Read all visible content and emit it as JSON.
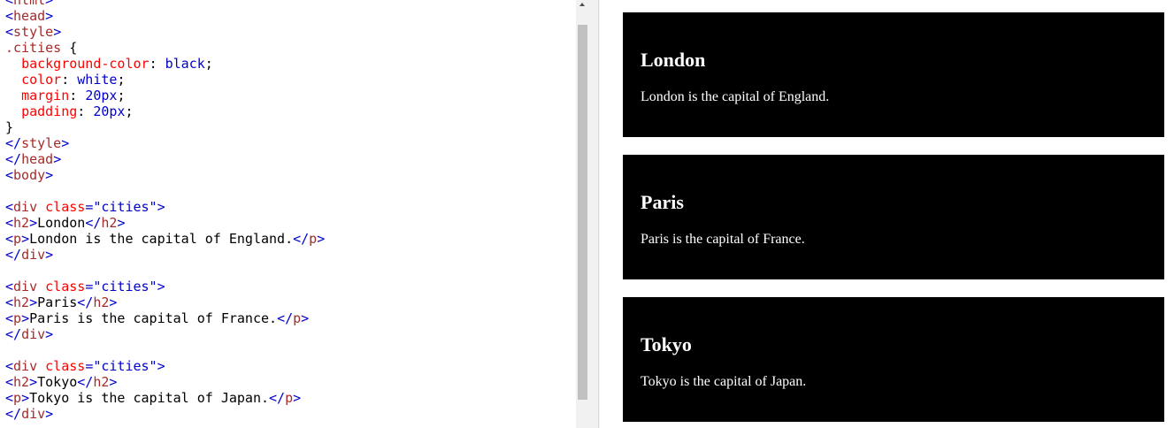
{
  "editor": {
    "lines": [
      [
        [
          "tok-bracket",
          "<"
        ],
        [
          "tok-tag",
          "html"
        ],
        [
          "tok-bracket",
          ">"
        ]
      ],
      [
        [
          "tok-bracket",
          "<"
        ],
        [
          "tok-tag",
          "head"
        ],
        [
          "tok-bracket",
          ">"
        ]
      ],
      [
        [
          "tok-bracket",
          "<"
        ],
        [
          "tok-tag",
          "style"
        ],
        [
          "tok-bracket",
          ">"
        ]
      ],
      [
        [
          "tok-selector",
          ".cities"
        ],
        [
          "tok-punct",
          " {"
        ]
      ],
      [
        [
          "tok-punct",
          "  "
        ],
        [
          "tok-prop",
          "background-color"
        ],
        [
          "tok-punct",
          ": "
        ],
        [
          "tok-value",
          "black"
        ],
        [
          "tok-punct",
          ";"
        ]
      ],
      [
        [
          "tok-punct",
          "  "
        ],
        [
          "tok-prop",
          "color"
        ],
        [
          "tok-punct",
          ": "
        ],
        [
          "tok-value",
          "white"
        ],
        [
          "tok-punct",
          ";"
        ]
      ],
      [
        [
          "tok-punct",
          "  "
        ],
        [
          "tok-prop",
          "margin"
        ],
        [
          "tok-punct",
          ": "
        ],
        [
          "tok-value",
          "20px"
        ],
        [
          "tok-punct",
          ";"
        ]
      ],
      [
        [
          "tok-punct",
          "  "
        ],
        [
          "tok-prop",
          "padding"
        ],
        [
          "tok-punct",
          ": "
        ],
        [
          "tok-value",
          "20px"
        ],
        [
          "tok-punct",
          ";"
        ]
      ],
      [
        [
          "tok-punct",
          "}"
        ]
      ],
      [
        [
          "tok-bracket",
          "</"
        ],
        [
          "tok-tag",
          "style"
        ],
        [
          "tok-bracket",
          ">"
        ]
      ],
      [
        [
          "tok-bracket",
          "</"
        ],
        [
          "tok-tag",
          "head"
        ],
        [
          "tok-bracket",
          ">"
        ]
      ],
      [
        [
          "tok-bracket",
          "<"
        ],
        [
          "tok-tag",
          "body"
        ],
        [
          "tok-bracket",
          ">"
        ]
      ],
      [],
      [
        [
          "tok-bracket",
          "<"
        ],
        [
          "tok-tag",
          "div"
        ],
        [
          "tok-text",
          " "
        ],
        [
          "tok-attr",
          "class"
        ],
        [
          "tok-bracket",
          "="
        ],
        [
          "tok-value",
          "\"cities\""
        ],
        [
          "tok-bracket",
          ">"
        ]
      ],
      [
        [
          "tok-bracket",
          "<"
        ],
        [
          "tok-tag",
          "h2"
        ],
        [
          "tok-bracket",
          ">"
        ],
        [
          "tok-text",
          "London"
        ],
        [
          "tok-bracket",
          "</"
        ],
        [
          "tok-tag",
          "h2"
        ],
        [
          "tok-bracket",
          ">"
        ]
      ],
      [
        [
          "tok-bracket",
          "<"
        ],
        [
          "tok-tag",
          "p"
        ],
        [
          "tok-bracket",
          ">"
        ],
        [
          "tok-text",
          "London is the capital of England."
        ],
        [
          "tok-bracket",
          "</"
        ],
        [
          "tok-tag",
          "p"
        ],
        [
          "tok-bracket",
          ">"
        ]
      ],
      [
        [
          "tok-bracket",
          "</"
        ],
        [
          "tok-tag",
          "div"
        ],
        [
          "tok-bracket",
          ">"
        ]
      ],
      [],
      [
        [
          "tok-bracket",
          "<"
        ],
        [
          "tok-tag",
          "div"
        ],
        [
          "tok-text",
          " "
        ],
        [
          "tok-attr",
          "class"
        ],
        [
          "tok-bracket",
          "="
        ],
        [
          "tok-value",
          "\"cities\""
        ],
        [
          "tok-bracket",
          ">"
        ]
      ],
      [
        [
          "tok-bracket",
          "<"
        ],
        [
          "tok-tag",
          "h2"
        ],
        [
          "tok-bracket",
          ">"
        ],
        [
          "tok-text",
          "Paris"
        ],
        [
          "tok-bracket",
          "</"
        ],
        [
          "tok-tag",
          "h2"
        ],
        [
          "tok-bracket",
          ">"
        ]
      ],
      [
        [
          "tok-bracket",
          "<"
        ],
        [
          "tok-tag",
          "p"
        ],
        [
          "tok-bracket",
          ">"
        ],
        [
          "tok-text",
          "Paris is the capital of France."
        ],
        [
          "tok-bracket",
          "</"
        ],
        [
          "tok-tag",
          "p"
        ],
        [
          "tok-bracket",
          ">"
        ]
      ],
      [
        [
          "tok-bracket",
          "</"
        ],
        [
          "tok-tag",
          "div"
        ],
        [
          "tok-bracket",
          ">"
        ]
      ],
      [],
      [
        [
          "tok-bracket",
          "<"
        ],
        [
          "tok-tag",
          "div"
        ],
        [
          "tok-text",
          " "
        ],
        [
          "tok-attr",
          "class"
        ],
        [
          "tok-bracket",
          "="
        ],
        [
          "tok-value",
          "\"cities\""
        ],
        [
          "tok-bracket",
          ">"
        ]
      ],
      [
        [
          "tok-bracket",
          "<"
        ],
        [
          "tok-tag",
          "h2"
        ],
        [
          "tok-bracket",
          ">"
        ],
        [
          "tok-text",
          "Tokyo"
        ],
        [
          "tok-bracket",
          "</"
        ],
        [
          "tok-tag",
          "h2"
        ],
        [
          "tok-bracket",
          ">"
        ]
      ],
      [
        [
          "tok-bracket",
          "<"
        ],
        [
          "tok-tag",
          "p"
        ],
        [
          "tok-bracket",
          ">"
        ],
        [
          "tok-text",
          "Tokyo is the capital of Japan."
        ],
        [
          "tok-bracket",
          "</"
        ],
        [
          "tok-tag",
          "p"
        ],
        [
          "tok-bracket",
          ">"
        ]
      ],
      [
        [
          "tok-bracket",
          "</"
        ],
        [
          "tok-tag",
          "div"
        ],
        [
          "tok-bracket",
          ">"
        ]
      ]
    ]
  },
  "preview": {
    "cities": [
      {
        "heading": "London",
        "text": "London is the capital of England."
      },
      {
        "heading": "Paris",
        "text": "Paris is the capital of France."
      },
      {
        "heading": "Tokyo",
        "text": "Tokyo is the capital of Japan."
      }
    ]
  },
  "colors": {
    "tag_bracket": "#0000cd",
    "tag_name": "#a52a2a",
    "attribute": "#ff0000",
    "value": "#0000cd",
    "city_background": "#000000",
    "city_text": "#ffffff"
  }
}
